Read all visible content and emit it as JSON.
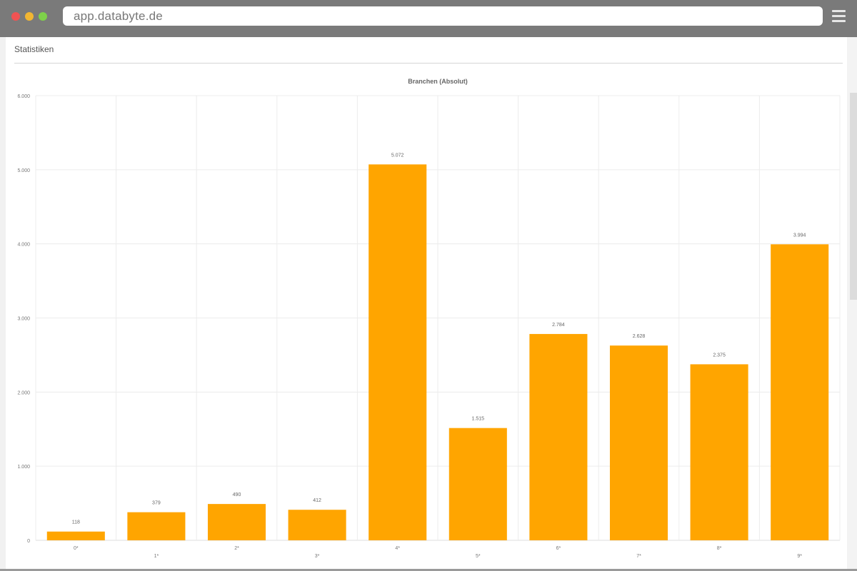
{
  "browser": {
    "url": "app.databyte.de",
    "traffic_colors": {
      "red": "#f05353",
      "yellow": "#f2b632",
      "green": "#7ed14a"
    }
  },
  "page": {
    "section_title": "Statistiken"
  },
  "chart_data": {
    "type": "bar",
    "title": "Branchen (Absolut)",
    "categories": [
      "0*",
      "1*",
      "2*",
      "3*",
      "4*",
      "5*",
      "6*",
      "7*",
      "8*",
      "9*"
    ],
    "values": [
      118,
      379,
      490,
      412,
      5072,
      1515,
      2784,
      2628,
      2375,
      3994
    ],
    "value_labels": [
      "118",
      "379",
      "490",
      "412",
      "5.072",
      "1.515",
      "2.784",
      "2.628",
      "2.375",
      "3.994"
    ],
    "ylim": [
      0,
      6000
    ],
    "yticks": [
      0,
      1000,
      2000,
      3000,
      4000,
      5000,
      6000
    ],
    "ytick_labels": [
      "0",
      "1.000",
      "2.000",
      "3.000",
      "4.000",
      "5.000",
      "6.000"
    ],
    "grid": true,
    "bar_color": "#ffa500"
  }
}
